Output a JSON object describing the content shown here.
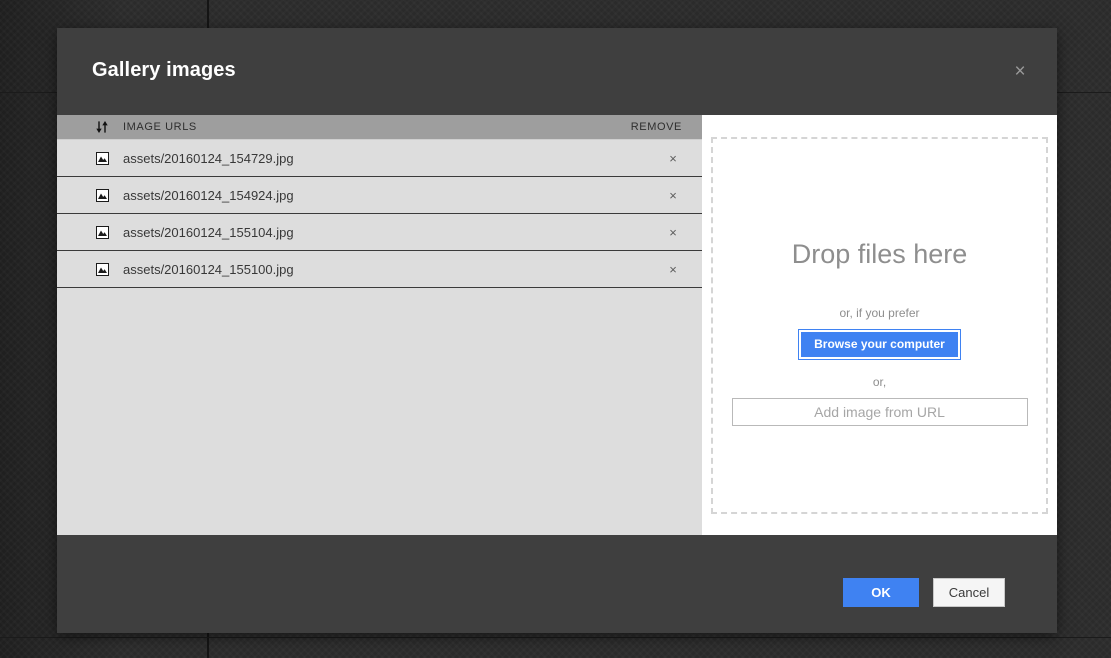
{
  "modal": {
    "title": "Gallery images",
    "close_label": "×"
  },
  "list": {
    "sort_icon": "sort-updown-icon",
    "header_url_label": "IMAGE URLS",
    "header_remove_label": "REMOVE",
    "remove_symbol": "×",
    "row_icon": "image-thumbnail-icon",
    "rows": [
      {
        "url": "assets/20160124_154729.jpg"
      },
      {
        "url": "assets/20160124_154924.jpg"
      },
      {
        "url": "assets/20160124_155104.jpg"
      },
      {
        "url": "assets/20160124_155100.jpg"
      }
    ]
  },
  "dropzone": {
    "headline": "Drop files here",
    "or_prefer": "or, if you prefer",
    "browse_label": "Browse your computer",
    "or": "or,",
    "url_placeholder": "Add image from URL",
    "url_value": ""
  },
  "footer": {
    "ok_label": "OK",
    "cancel_label": "Cancel"
  },
  "colors": {
    "accent_blue": "#3f82f2",
    "modal_chrome": "#3f3f3f",
    "list_header_gray": "#9e9e9e",
    "list_row_gray": "#dddddd"
  }
}
